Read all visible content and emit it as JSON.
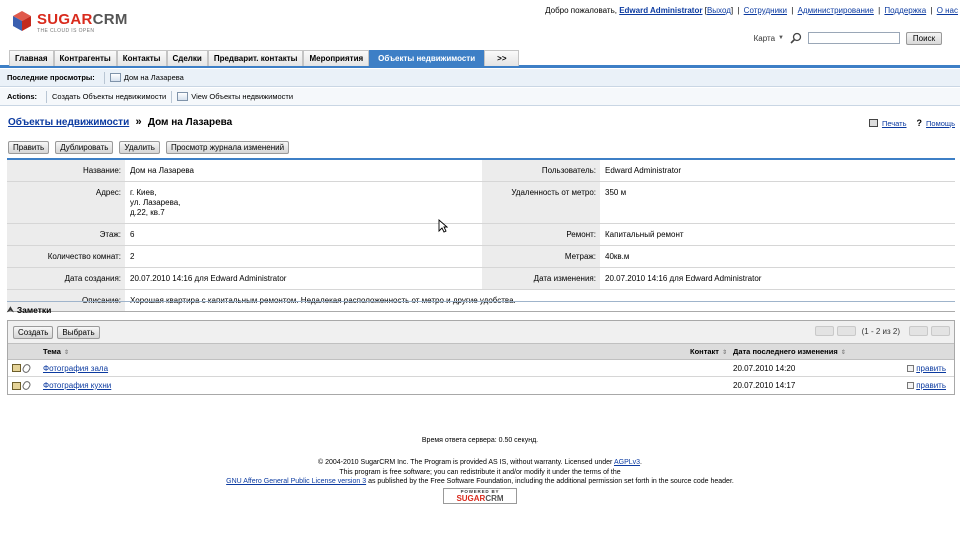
{
  "header": {
    "logo": {
      "brand_sugar": "SUGAR",
      "brand_crm": "CRM",
      "tagline": "THE CLOUD IS OPEN"
    },
    "welcome_prefix": "Добро пожаловать,",
    "user_name": "Edward Administrator",
    "logout_label": "Выход",
    "links": [
      "Сотрудники",
      "Администрирование",
      "Поддержка",
      "О нас"
    ],
    "map_label": "Карта",
    "search_placeholder": "",
    "search_button": "Поиск"
  },
  "tabs": [
    {
      "label": "Главная",
      "active": false
    },
    {
      "label": "Контрагенты",
      "active": false
    },
    {
      "label": "Контакты",
      "active": false
    },
    {
      "label": "Сделки",
      "active": false
    },
    {
      "label": "Предварит. контакты",
      "active": false
    },
    {
      "label": "Мероприятия",
      "active": false
    },
    {
      "label": "Объекты недвижимости",
      "active": true
    },
    {
      "label": ">>",
      "active": false
    }
  ],
  "recent": {
    "label": "Последние просмотры:",
    "items": [
      "Дом на Лазарева"
    ]
  },
  "actions": {
    "label": "Actions:",
    "items": [
      "Создать Объекты недвижимости",
      "View Объекты недвижимости"
    ]
  },
  "title": {
    "module": "Объекты недвижимости",
    "separator": "»",
    "record": "Дом на Лазарева",
    "print": "Печать",
    "help": "Помощь"
  },
  "buttons": [
    "Править",
    "Дублировать",
    "Удалить",
    "Просмотр журнала изменений"
  ],
  "detail": {
    "rows": [
      {
        "l1": "Название:",
        "v1": [
          "Дом на Лазарева"
        ],
        "l2": "Пользователь:",
        "v2": "Edward Administrator"
      },
      {
        "l1": "Адрес:",
        "v1": [
          "г. Киев,",
          "ул. Лазарева,",
          "д.22, кв.7"
        ],
        "l2": "Удаленность от метро:",
        "v2": "350 м"
      },
      {
        "l1": "Этаж:",
        "v1": [
          "6"
        ],
        "l2": "Ремонт:",
        "v2": "Капитальный ремонт"
      },
      {
        "l1": "Количество комнат:",
        "v1": [
          "2"
        ],
        "l2": "Метраж:",
        "v2": "40кв.м"
      },
      {
        "l1": "Дата создания:",
        "v1": [
          "20.07.2010 14:16 для Edward Administrator"
        ],
        "l2": "Дата изменения:",
        "v2": "20.07.2010 14:16 для Edward Administrator"
      }
    ],
    "description_label": "Описание:",
    "description": "Хорошая квартира с капитальным ремонтом. Недалекая расположенность от метро и другие удобства."
  },
  "notes": {
    "title": "Заметки",
    "create_button": "Создать",
    "select_button": "Выбрать",
    "pager": "(1 - 2 из 2)",
    "columns": {
      "subject": "Тема",
      "contact": "Контакт",
      "date": "Дата последнего изменения"
    },
    "rows": [
      {
        "subject": "Фотография зала",
        "contact": "",
        "date": "20.07.2010 14:20",
        "edit": "править"
      },
      {
        "subject": "Фотография кухни",
        "contact": "",
        "date": "20.07.2010 14:17",
        "edit": "править"
      }
    ]
  },
  "footer": {
    "server_time": "Время ответа сервера: 0.50 секунд.",
    "copyright_1_prefix": "© 2004-2010 SugarCRM Inc. The Program is provided AS IS, without warranty. Licensed under",
    "copyright_1_link": "AGPLv3",
    "copyright_2": "This program is free software; you can redistribute it and/or modify it under the terms of the",
    "copyright_3_link": "GNU Affero General Public License version 3",
    "copyright_3_suffix": "as published by the Free Software Foundation, including the additional permission set forth in the source code header.",
    "powered_by": "POWERED BY",
    "powered_sugar": "SUGAR",
    "powered_crm": "CRM"
  },
  "colors": {
    "accent": "#3d7fc6",
    "brand_red": "#d92a1c",
    "link": "#0b3aa0"
  }
}
